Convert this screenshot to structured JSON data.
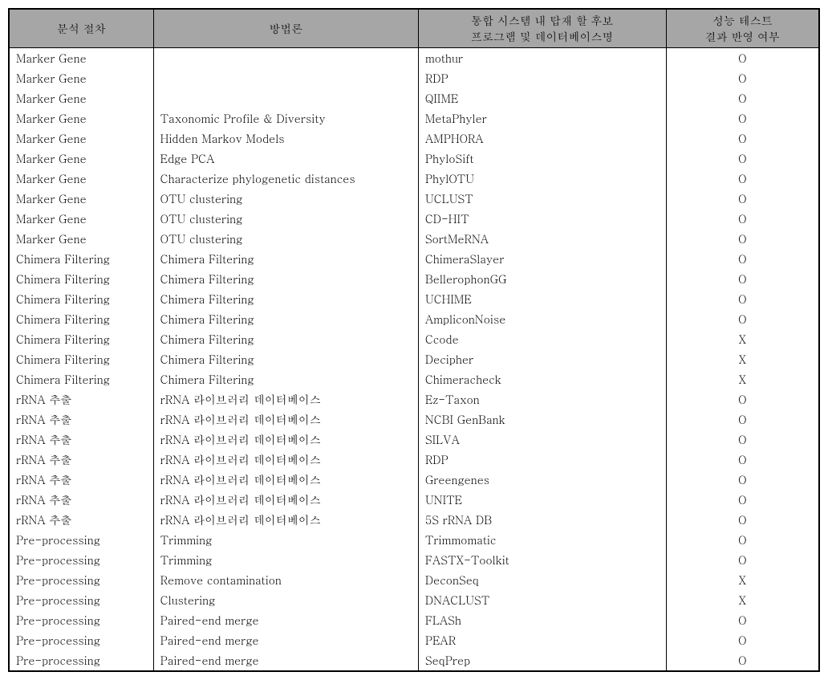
{
  "headers": {
    "col1": "분석 절차",
    "col2": "방법론",
    "col3_line1": "통합 시스템 내 탑재 할 후보",
    "col3_line2": "프로그램 및 데이터베이스명",
    "col4_line1": "성능 테스트",
    "col4_line2": "결과 반영 여부"
  },
  "rows": [
    {
      "c1": "Marker Gene",
      "c2": "",
      "c3": "mothur",
      "c4": "O"
    },
    {
      "c1": "Marker Gene",
      "c2": "",
      "c3": "RDP",
      "c4": "O"
    },
    {
      "c1": "Marker Gene",
      "c2": "",
      "c3": "QIIME",
      "c4": "O"
    },
    {
      "c1": "Marker Gene",
      "c2": "Taxonomic Profile & Diversity",
      "c3": "MetaPhyler",
      "c4": "O"
    },
    {
      "c1": "Marker Gene",
      "c2": "Hidden Markov Models",
      "c3": "AMPHORA",
      "c4": "O"
    },
    {
      "c1": "Marker Gene",
      "c2": "Edge PCA",
      "c3": "PhyloSift",
      "c4": "O"
    },
    {
      "c1": "Marker Gene",
      "c2": "Characterize phylogenetic distances",
      "c3": "PhylOTU",
      "c4": "O"
    },
    {
      "c1": "Marker Gene",
      "c2": "OTU clustering",
      "c3": "UCLUST",
      "c4": "O"
    },
    {
      "c1": "Marker Gene",
      "c2": "OTU clustering",
      "c3": "CD-HIT",
      "c4": "O"
    },
    {
      "c1": "Marker Gene",
      "c2": "OTU clustering",
      "c3": "SortMeRNA",
      "c4": "O"
    },
    {
      "c1": "Chimera Filtering",
      "c2": "Chimera Filtering",
      "c3": "ChimeraSlayer",
      "c4": "O"
    },
    {
      "c1": "Chimera Filtering",
      "c2": "Chimera Filtering",
      "c3": "BellerophonGG",
      "c4": "O"
    },
    {
      "c1": "Chimera Filtering",
      "c2": "Chimera Filtering",
      "c3": "UCHIME",
      "c4": "O"
    },
    {
      "c1": "Chimera Filtering",
      "c2": "Chimera Filtering",
      "c3": "AmpliconNoise",
      "c4": "O"
    },
    {
      "c1": "Chimera Filtering",
      "c2": "Chimera Filtering",
      "c3": "Ccode",
      "c4": "X"
    },
    {
      "c1": "Chimera Filtering",
      "c2": "Chimera Filtering",
      "c3": "Decipher",
      "c4": "X"
    },
    {
      "c1": "Chimera Filtering",
      "c2": "Chimera Filtering",
      "c3": "Chimeracheck",
      "c4": "X"
    },
    {
      "c1": "rRNA 추출",
      "c2": "rRNA 라이브러리 데이터베이스",
      "c3": "Ez-Taxon",
      "c4": "O"
    },
    {
      "c1": "rRNA 추출",
      "c2": "rRNA 라이브러리 데이터베이스",
      "c3": "NCBI GenBank",
      "c4": "O"
    },
    {
      "c1": "rRNA 추출",
      "c2": "rRNA 라이브러리 데이터베이스",
      "c3": "SILVA",
      "c4": "O"
    },
    {
      "c1": "rRNA 추출",
      "c2": "rRNA 라이브러리 데이터베이스",
      "c3": "RDP",
      "c4": "O"
    },
    {
      "c1": "rRNA 추출",
      "c2": "rRNA 라이브러리 데이터베이스",
      "c3": "Greengenes",
      "c4": "O"
    },
    {
      "c1": "rRNA 추출",
      "c2": "rRNA 라이브러리 데이터베이스",
      "c3": "UNITE",
      "c4": "O"
    },
    {
      "c1": "rRNA 추출",
      "c2": "rRNA 라이브러리 데이터베이스",
      "c3": "5S rRNA DB",
      "c4": "O"
    },
    {
      "c1": "Pre-processing",
      "c2": "Trimming",
      "c3": "Trimmomatic",
      "c4": "O"
    },
    {
      "c1": "Pre-processing",
      "c2": "Trimming",
      "c3": "FASTX-Toolkit",
      "c4": "O"
    },
    {
      "c1": "Pre-processing",
      "c2": "Remove contamination",
      "c3": "DeconSeq",
      "c4": "X"
    },
    {
      "c1": "Pre-processing",
      "c2": "Clustering",
      "c3": "DNACLUST",
      "c4": "X"
    },
    {
      "c1": "Pre-processing",
      "c2": "Paired-end merge",
      "c3": "FLASh",
      "c4": "O"
    },
    {
      "c1": "Pre-processing",
      "c2": "Paired-end merge",
      "c3": "PEAR",
      "c4": "O"
    },
    {
      "c1": "Pre-processing",
      "c2": "Paired-end merge",
      "c3": "SeqPrep",
      "c4": "O"
    }
  ]
}
